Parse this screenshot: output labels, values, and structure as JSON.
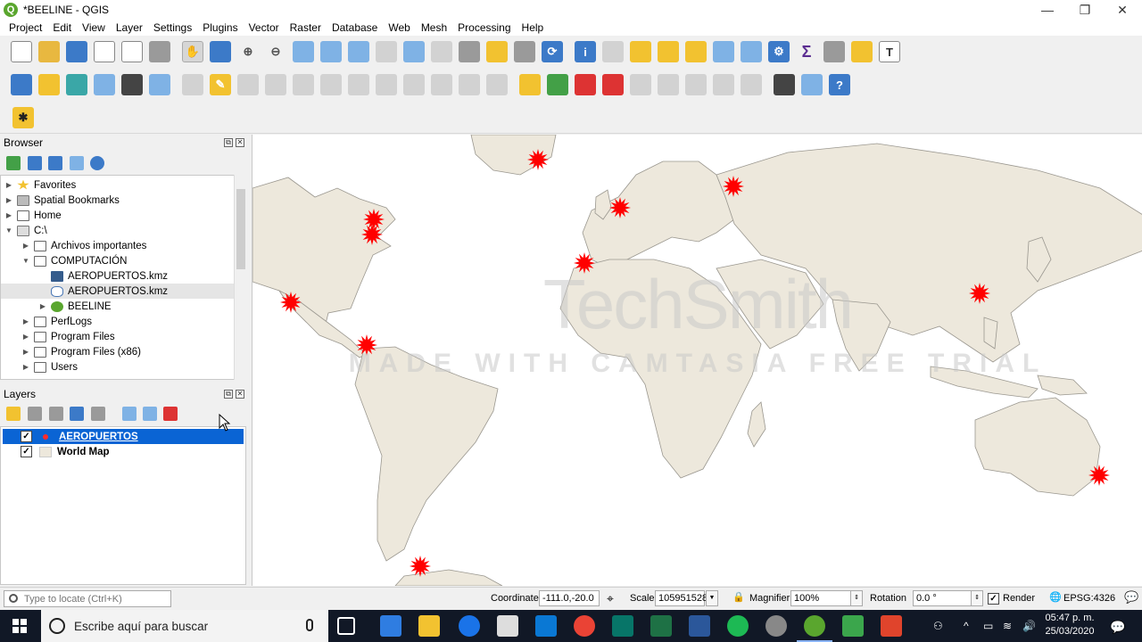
{
  "window": {
    "title": "*BEELINE - QGIS",
    "app_icon": "Q",
    "controls": [
      "minimize-icon",
      "maximize-icon",
      "close-icon"
    ]
  },
  "menu": [
    "Project",
    "Edit",
    "View",
    "Layer",
    "Settings",
    "Plugins",
    "Vector",
    "Raster",
    "Database",
    "Web",
    "Mesh",
    "Processing",
    "Help"
  ],
  "browser": {
    "title": "Browser",
    "items": [
      {
        "label": "Favorites",
        "icon": "star-icon",
        "level": 0
      },
      {
        "label": "Spatial Bookmarks",
        "icon": "bookmark-icon",
        "level": 0
      },
      {
        "label": "Home",
        "icon": "home-icon",
        "level": 0
      },
      {
        "label": "C:\\",
        "icon": "drive-icon",
        "level": 0
      },
      {
        "label": "Archivos importantes",
        "icon": "folder-icon",
        "level": 1
      },
      {
        "label": "COMPUTACIÓN",
        "icon": "folder-open-icon",
        "level": 1
      },
      {
        "label": "AEROPUERTOS.kmz",
        "icon": "kmz-icon",
        "level": 2
      },
      {
        "label": "AEROPUERTOS.kmz",
        "icon": "polygon-layer-icon",
        "level": 2
      },
      {
        "label": "BEELINE",
        "icon": "qgis-project-icon",
        "level": 2
      },
      {
        "label": "PerfLogs",
        "icon": "folder-icon",
        "level": 1
      },
      {
        "label": "Program Files",
        "icon": "folder-icon",
        "level": 1
      },
      {
        "label": "Program Files (x86)",
        "icon": "folder-icon",
        "level": 1
      },
      {
        "label": "Users",
        "icon": "folder-icon",
        "level": 1
      }
    ]
  },
  "layers": {
    "title": "Layers",
    "items": [
      {
        "name": "AEROPUERTOS",
        "checked": true,
        "selected": true
      },
      {
        "name": "World Map",
        "checked": true,
        "selected": false
      }
    ]
  },
  "map": {
    "watermark_brand": "TechSmith",
    "watermark_text": "MADE WITH CAMTASIA FREE TRIAL",
    "marker_color": "#ff0000"
  },
  "status": {
    "locate_placeholder": "Type to locate (Ctrl+K)",
    "coordinate_label": "Coordinate",
    "coordinate_value": "-111.0,-20.0",
    "scale_label": "Scale",
    "scale_value": "105951528",
    "magnifier_label": "Magnifier",
    "magnifier_value": "100%",
    "rotation_label": "Rotation",
    "rotation_value": "0.0 °",
    "render_label": "Render",
    "crs": "EPSG:4326"
  },
  "taskbar": {
    "search_text": "Escribe aquí para buscar",
    "time": "05:47 p. m.",
    "date": "25/03/2020"
  }
}
